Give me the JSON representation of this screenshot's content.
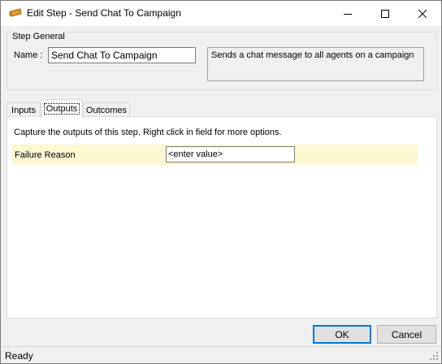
{
  "window": {
    "title": "Edit Step - Send Chat To Campaign",
    "icon": "step-icon"
  },
  "step_general": {
    "legend": "Step General",
    "name_label": "Name :",
    "name_value": "Send Chat To Campaign",
    "description": "Sends a chat message to all agents on a campaign"
  },
  "tabs": [
    {
      "label": "Inputs",
      "active": false
    },
    {
      "label": "Outputs",
      "active": true
    },
    {
      "label": "Outcomes",
      "active": false
    }
  ],
  "outputs_panel": {
    "instructions": "Capture the outputs of this step.  Right click in field for more options.",
    "rows": [
      {
        "label": "Failure Reason",
        "value": "<enter value>"
      }
    ]
  },
  "buttons": {
    "ok": "OK",
    "cancel": "Cancel"
  },
  "status": {
    "text": "Ready"
  },
  "colors": {
    "row_highlight": "#fdf7d2",
    "default_button_border": "#0078d7",
    "dialog_background": "#f0f0f0"
  }
}
